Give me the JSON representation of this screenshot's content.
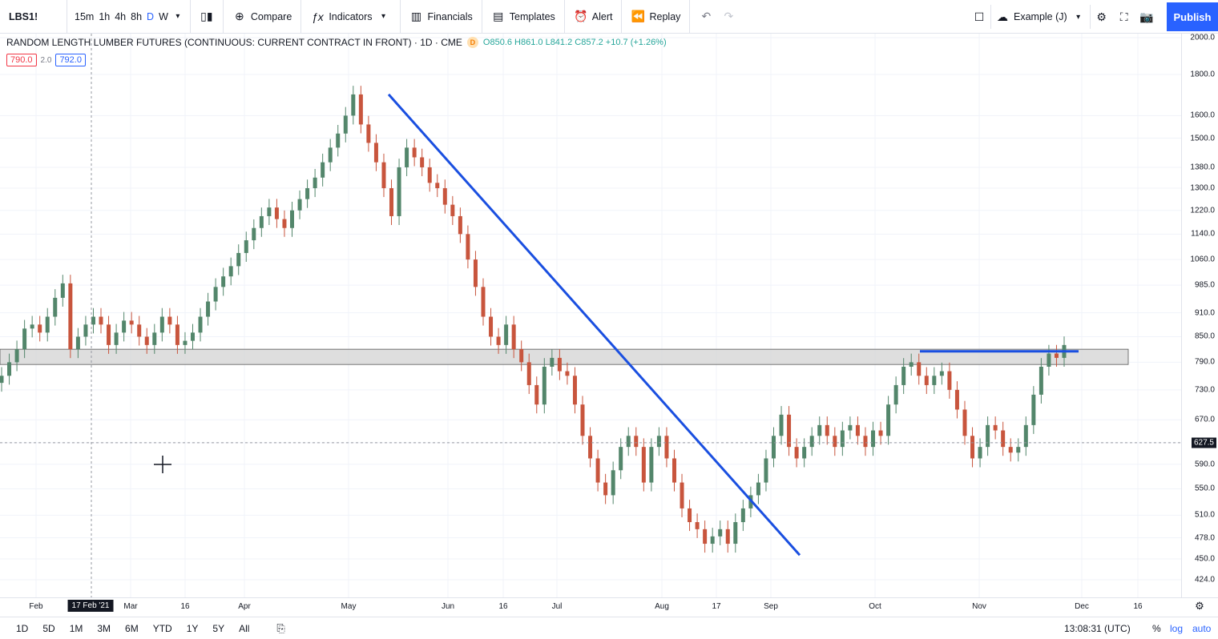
{
  "toolbar": {
    "symbol": "LBS1!",
    "intervals": [
      "15m",
      "1h",
      "4h",
      "8h",
      "D",
      "W"
    ],
    "active_interval": "D",
    "compare": "Compare",
    "indicators": "Indicators",
    "financials": "Financials",
    "templates": "Templates",
    "alert": "Alert",
    "replay": "Replay",
    "layout_name": "Example (J)",
    "publish": "Publish"
  },
  "legend": {
    "title": "RANDOM LENGTH LUMBER FUTURES (CONTINUOUS: CURRENT CONTRACT IN FRONT) · 1D · CME",
    "source_badge": "D",
    "ohlc": "O850.6 H861.0 L841.2 C857.2 +10.7 (+1.26%)",
    "bid": "790.0",
    "spread": "2.0",
    "ask": "792.0"
  },
  "price_axis": {
    "labels": [
      "2000.0",
      "1800.0",
      "1600.0",
      "1500.0",
      "1380.0",
      "1300.0",
      "1220.0",
      "1140.0",
      "1060.0",
      "985.0",
      "910.0",
      "850.0",
      "790.0",
      "730.0",
      "670.0",
      "627.5",
      "590.0",
      "550.0",
      "510.0",
      "478.0",
      "450.0",
      "424.0"
    ],
    "current_price": "627.5"
  },
  "time_axis": {
    "labels": [
      "Feb",
      "Mar",
      "16",
      "Apr",
      "May",
      "Jun",
      "16",
      "Jul",
      "Aug",
      "17",
      "Sep",
      "Oct",
      "Nov",
      "Dec",
      "16"
    ],
    "crosshair_date": "17 Feb '21"
  },
  "bottombar": {
    "ranges": [
      "1D",
      "5D",
      "1M",
      "3M",
      "6M",
      "YTD",
      "1Y",
      "5Y",
      "All"
    ],
    "time": "13:08:31 (UTC)",
    "percent": "%",
    "log": "log",
    "auto": "auto"
  },
  "colors": {
    "up": "#53866b",
    "down": "#c8553d",
    "accent": "#2962ff",
    "trendline": "#1a4fe0",
    "zone": "#d6d6d6"
  },
  "chart_data": {
    "type": "candlestick",
    "symbol": "LBS1!",
    "interval": "1D",
    "scale": "log",
    "ylim": [
      424,
      2000
    ],
    "zone": [
      785,
      820
    ],
    "closes": [
      760,
      790,
      820,
      870,
      880,
      860,
      900,
      950,
      990,
      820,
      850,
      880,
      900,
      880,
      830,
      860,
      890,
      880,
      850,
      830,
      860,
      900,
      880,
      830,
      840,
      860,
      900,
      940,
      980,
      1010,
      1040,
      1080,
      1120,
      1160,
      1200,
      1230,
      1190,
      1160,
      1220,
      1260,
      1300,
      1340,
      1400,
      1460,
      1520,
      1600,
      1700,
      1560,
      1480,
      1400,
      1300,
      1200,
      1380,
      1460,
      1420,
      1380,
      1320,
      1300,
      1240,
      1200,
      1140,
      1060,
      980,
      900,
      850,
      830,
      880,
      820,
      790,
      740,
      700,
      780,
      800,
      770,
      760,
      700,
      640,
      600,
      560,
      540,
      580,
      620,
      640,
      620,
      560,
      620,
      640,
      600,
      560,
      520,
      500,
      490,
      470,
      480,
      490,
      470,
      500,
      520,
      540,
      560,
      600,
      640,
      680,
      620,
      600,
      620,
      640,
      660,
      640,
      620,
      650,
      660,
      640,
      620,
      650,
      640,
      700,
      740,
      780,
      790,
      760,
      740,
      760,
      770,
      730,
      690,
      640,
      600,
      620,
      660,
      650,
      620,
      610,
      620,
      660,
      720,
      780,
      810,
      800,
      830
    ],
    "trendline": {
      "start": [
        "May",
        1700
      ],
      "end": [
        "Sep",
        455
      ]
    },
    "resistance_line": 815
  }
}
